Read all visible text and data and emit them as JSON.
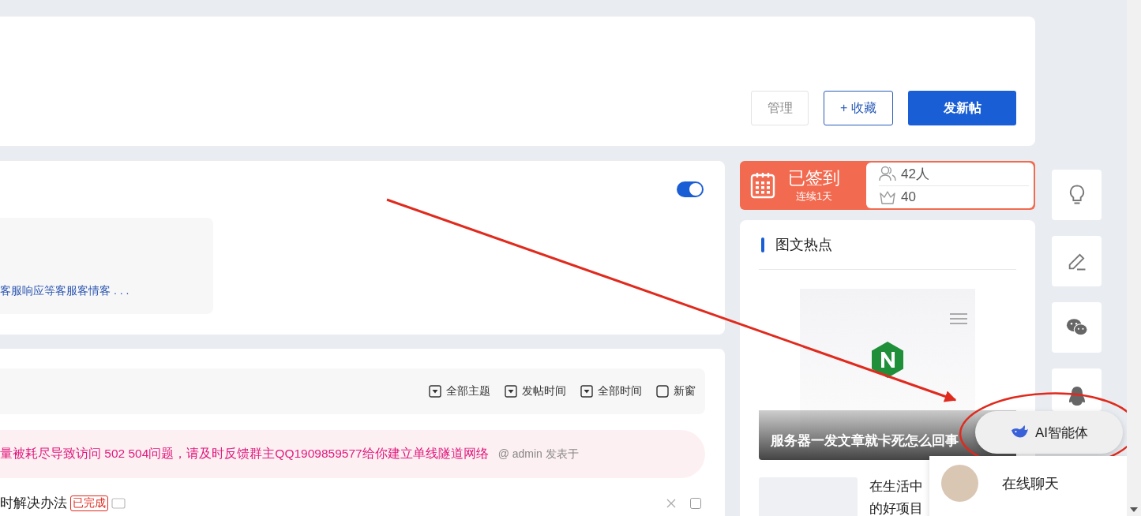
{
  "header": {
    "buttons": [
      {
        "label": "管理",
        "kind": "plain"
      },
      {
        "label": "+ 收藏",
        "kind": "outline"
      },
      {
        "label": "发新帖",
        "kind": "primary"
      }
    ]
  },
  "intro_card": {
    "toggle": {
      "on": true
    },
    "text": "客服响应等客服客情客 . . ."
  },
  "thread_list": {
    "filters": [
      {
        "label": "全部主题",
        "kind": "dropdown"
      },
      {
        "label": "发帖时间",
        "kind": "dropdown"
      },
      {
        "label": "全部时间",
        "kind": "dropdown"
      },
      {
        "label": "新窗",
        "kind": "checkbox",
        "checked": false
      }
    ],
    "notice": {
      "text": "量被耗尽导致访问 502 504问题，请及时反馈群主QQ1909859577给你建立单线隧道网络",
      "byline": "@ admin 发表于"
    },
    "rows": [
      {
        "title": "时解决办法",
        "tag": "已完成",
        "checked": false
      }
    ]
  },
  "signin": {
    "title": "已签到",
    "subtitle": "连续1天",
    "members": "42人",
    "points": "40"
  },
  "hot": {
    "title": "图文热点",
    "feature": {
      "caption": "服务器一发文章就卡死怎么回事"
    },
    "items": [
      {
        "lines": [
          "在生活中",
          "的好项目"
        ]
      }
    ]
  },
  "ai_button": {
    "label": "AI智能体"
  },
  "chat_popup": {
    "label": "在线聊天"
  }
}
